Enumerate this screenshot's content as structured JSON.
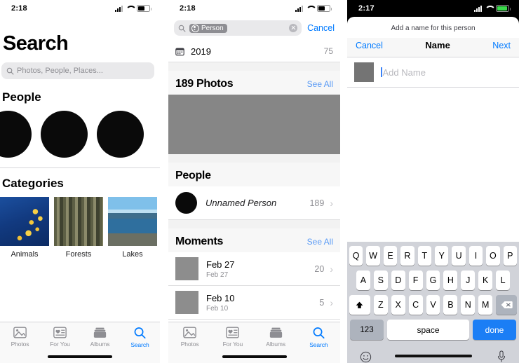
{
  "panel1": {
    "status": {
      "time": "2:18",
      "battery_level": "60",
      "signal": "signal-icon",
      "wifi": "wifi-icon"
    },
    "title": "Search",
    "search": {
      "placeholder": "Photos, People, Places...",
      "icon": "search-icon"
    },
    "people": {
      "heading": "People",
      "faces": [
        "face-1",
        "face-2",
        "face-3"
      ]
    },
    "categories": {
      "heading": "Categories",
      "items": [
        {
          "label": "Animals",
          "art": "art-animals"
        },
        {
          "label": "Forests",
          "art": "art-forest"
        },
        {
          "label": "Lakes",
          "art": "art-lake"
        },
        {
          "label": "",
          "art": "art-wood"
        }
      ]
    },
    "tabs": [
      {
        "label": "Photos",
        "icon": "photos-icon",
        "active": false
      },
      {
        "label": "For You",
        "icon": "for-you-icon",
        "active": false
      },
      {
        "label": "Albums",
        "icon": "albums-icon",
        "active": false
      },
      {
        "label": "Search",
        "icon": "search-icon",
        "active": true
      }
    ]
  },
  "panel2": {
    "status": {
      "time": "2:18",
      "battery_level": "60"
    },
    "search": {
      "token_label": "Person",
      "token_icon": "person-icon",
      "clear_icon": "clear-icon",
      "cancel_label": "Cancel"
    },
    "year_row": {
      "icon": "calendar-icon",
      "label": "2019",
      "count": "75"
    },
    "photos_section": {
      "heading": "189 Photos",
      "see_all": "See All"
    },
    "people_section": {
      "heading": "People",
      "person": {
        "name": "Unnamed Person",
        "count": "189",
        "chevron": "chevron-right-icon"
      }
    },
    "moments_section": {
      "heading": "Moments",
      "see_all": "See All",
      "items": [
        {
          "title": "Feb 27",
          "subtitle": "Feb 27",
          "count": "20"
        },
        {
          "title": "Feb 10",
          "subtitle": "Feb 10",
          "count": "5"
        }
      ]
    },
    "tabs": [
      {
        "label": "Photos",
        "icon": "photos-icon",
        "active": false
      },
      {
        "label": "For You",
        "icon": "for-you-icon",
        "active": false
      },
      {
        "label": "Albums",
        "icon": "albums-icon",
        "active": false
      },
      {
        "label": "Search",
        "icon": "search-icon",
        "active": true
      }
    ]
  },
  "panel3": {
    "status": {
      "time": "2:17",
      "battery_level": "95"
    },
    "sheet_hint": "Add a name for this person",
    "navbar": {
      "cancel": "Cancel",
      "title": "Name",
      "next": "Next"
    },
    "name_field": {
      "placeholder": "Add Name",
      "value": ""
    },
    "keyboard": {
      "row1": [
        "Q",
        "W",
        "E",
        "R",
        "T",
        "Y",
        "U",
        "I",
        "O",
        "P"
      ],
      "row2": [
        "A",
        "S",
        "D",
        "F",
        "G",
        "H",
        "J",
        "K",
        "L"
      ],
      "row3": [
        "Z",
        "X",
        "C",
        "V",
        "B",
        "N",
        "M"
      ],
      "shift_icon": "shift-icon",
      "backspace_icon": "backspace-icon",
      "num_label": "123",
      "space_label": "space",
      "done_label": "done",
      "emoji_icon": "emoji-icon",
      "mic_icon": "microphone-icon"
    }
  },
  "colors": {
    "accent_blue": "#007aff",
    "done_blue": "#1b7ef5",
    "see_all_blue": "#5a9bf6",
    "grey_text": "#8e8e93",
    "battery_green": "#3ad94b"
  }
}
